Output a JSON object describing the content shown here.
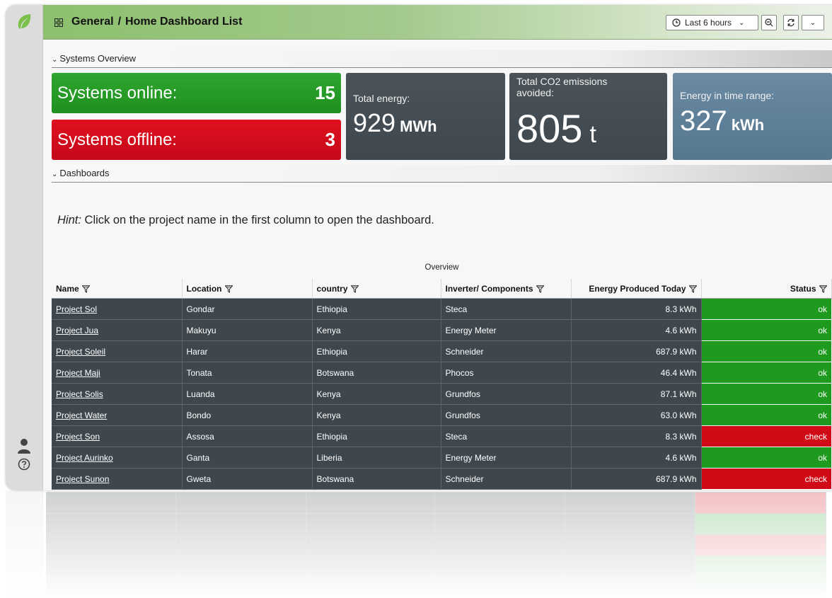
{
  "header": {
    "folder": "General",
    "separator": "/",
    "title": "Home Dashboard List"
  },
  "toolbar": {
    "time_range_label": "Last 6 hours"
  },
  "rows": {
    "systems_overview": "Systems Overview",
    "dashboards": "Dashboards"
  },
  "stats": {
    "online_label": "Systems online:",
    "online_value": "15",
    "offline_label": "Systems offline:",
    "offline_value": "3",
    "total_energy_label": "Total energy:",
    "total_energy_value": "929",
    "total_energy_unit": "MWh",
    "co2_label_line1": "Total CO2 emissions",
    "co2_label_line2": "avoided:",
    "co2_value": "805",
    "co2_unit": "t",
    "range_energy_label": "Energy in time range:",
    "range_energy_value": "327",
    "range_energy_unit": "kWh"
  },
  "hint": {
    "label": "Hint:",
    "text": " Click on the project name in the first column to open the dashboard."
  },
  "table": {
    "title": "Overview",
    "columns": [
      "Name",
      "Location",
      "country",
      "Inverter/ Components",
      "Energy Produced Today",
      "Status"
    ],
    "rows": [
      {
        "name": "Project Sol",
        "location": "Gondar",
        "country": "Ethiopia",
        "inverter": "Steca",
        "energy": "8.3 kWh",
        "status": "ok"
      },
      {
        "name": "Project Jua",
        "location": "Makuyu",
        "country": "Kenya",
        "inverter": "Energy Meter",
        "energy": "4.6 kWh",
        "status": "ok"
      },
      {
        "name": "Project Soleil",
        "location": "Harar",
        "country": "Ethiopia",
        "inverter": "Schneider",
        "energy": "687.9 kWh",
        "status": "ok"
      },
      {
        "name": "Project Maji",
        "location": "Tonata",
        "country": "Botswana",
        "inverter": "Phocos",
        "energy": "46.4 kWh",
        "status": "ok"
      },
      {
        "name": "Project Solis",
        "location": "Luanda",
        "country": "Kenya",
        "inverter": "Grundfos",
        "energy": "87.1 kWh",
        "status": "ok"
      },
      {
        "name": "Project Water",
        "location": "Bondo",
        "country": "Kenya",
        "inverter": "Grundfos",
        "energy": "63.0 kWh",
        "status": "ok"
      },
      {
        "name": "Project Son",
        "location": "Assosa",
        "country": "Ethiopia",
        "inverter": "Steca",
        "energy": "8.3 kWh",
        "status": "check"
      },
      {
        "name": "Project Aurinko",
        "location": "Ganta",
        "country": "Liberia",
        "inverter": "Energy Meter",
        "energy": "4.6 kWh",
        "status": "ok"
      },
      {
        "name": "Project Sunon",
        "location": "Gweta",
        "country": "Botswana",
        "inverter": "Schneider",
        "energy": "687.9 kWh",
        "status": "check"
      }
    ]
  },
  "colors": {
    "ok": "#1e9a1e",
    "check": "#d10a17",
    "cell_dark": "#3e474d",
    "brand_green": "#8cc06e"
  },
  "icons": {
    "logo": "leaf-icon",
    "dashboard": "grid-icon",
    "time": "clock-icon",
    "zoom": "zoom-out-icon",
    "refresh": "refresh-icon",
    "user": "user-icon",
    "help": "help-icon",
    "filter": "filter-icon"
  }
}
